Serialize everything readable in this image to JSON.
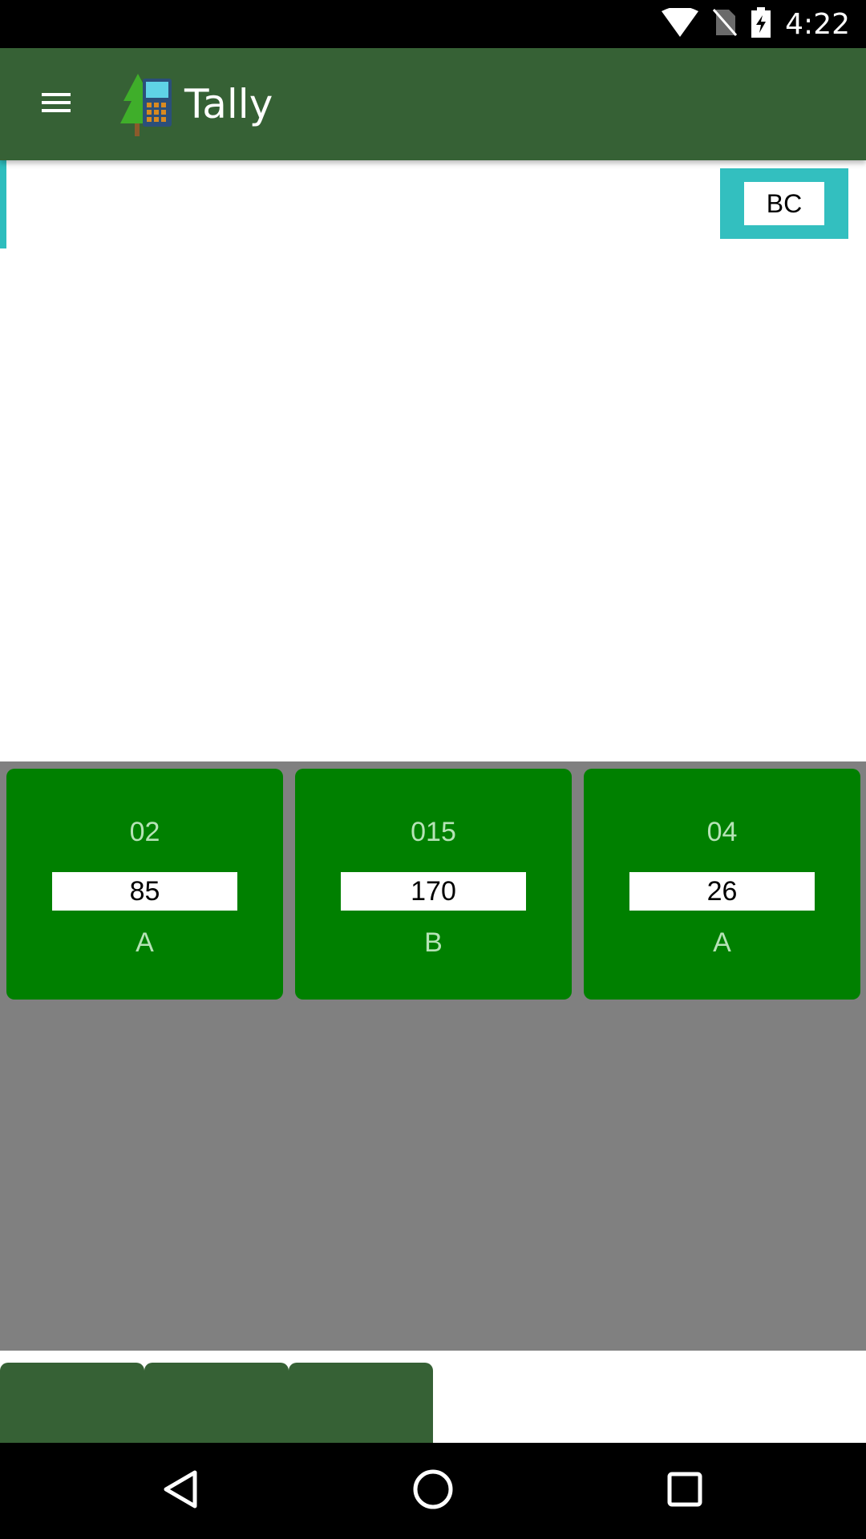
{
  "status_bar": {
    "time": "4:22",
    "icons": [
      "wifi-icon",
      "no-sim-icon",
      "battery-charging-icon"
    ]
  },
  "app_bar": {
    "title": "Tally",
    "menu_icon": "hamburger-menu-icon",
    "logo_icon": "tree-calculator-logo"
  },
  "input": {
    "button_label": "BC"
  },
  "cards": [
    {
      "code": "02",
      "value": "85",
      "grade": "A"
    },
    {
      "code": "015",
      "value": "170",
      "grade": "B"
    },
    {
      "code": "04",
      "value": "26",
      "grade": "A"
    }
  ],
  "bottom_tabs": [
    "",
    "",
    ""
  ],
  "nav_bar": {
    "icons": [
      "back-icon",
      "home-icon",
      "recents-icon"
    ]
  },
  "colors": {
    "app_bar": "#366135",
    "accent": "#33bfbf",
    "card": "#008000",
    "grid_background": "#808080"
  }
}
